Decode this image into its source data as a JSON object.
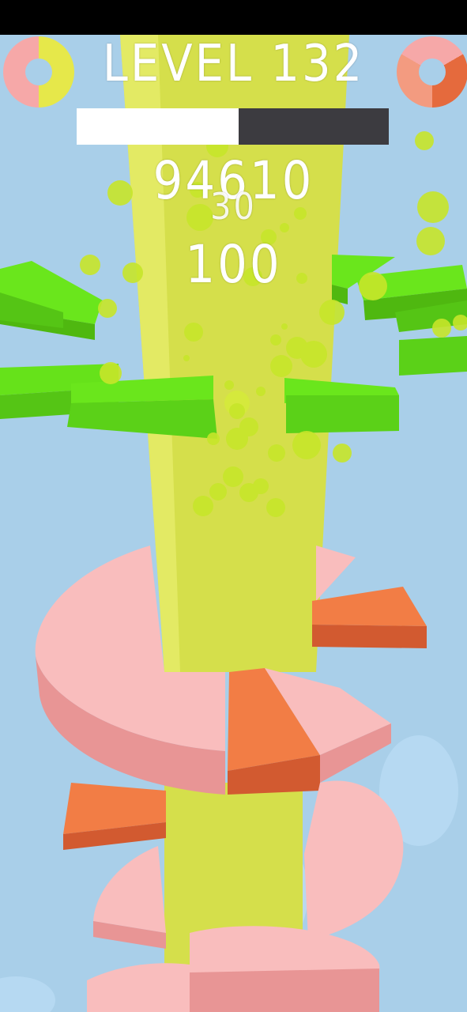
{
  "hud": {
    "level_label": "LEVEL 132",
    "score": "94610",
    "combo": "30",
    "bonus": "100",
    "progress_fraction": 0.52
  },
  "icons": {
    "left_ring": "color-ring-yellow-pink-icon",
    "right_ring": "color-ring-orange-pink-icon"
  },
  "colors": {
    "sky": "#a9cfe9",
    "tower": "#d2dc47",
    "platform_green": "#66e21a",
    "platform_pink": "#f9bdbd",
    "danger_orange": "#f27d45"
  }
}
